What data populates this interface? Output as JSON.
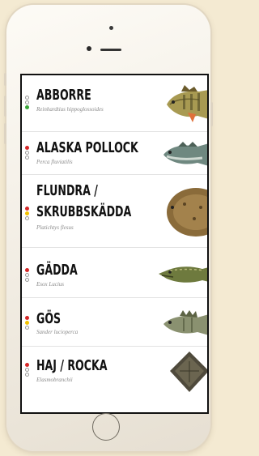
{
  "colors": {
    "background": "#f4ead2",
    "dot_red": "#d62828",
    "dot_yellow": "#f2c200",
    "dot_green": "#3aa63a",
    "dot_empty_border": "#9a9a9a"
  },
  "fish_list": [
    {
      "name_line1": "ABBORRE",
      "name_line2": "",
      "latin": "Reinhardtius hippoglossoides",
      "status": "green",
      "icon": "perch-icon"
    },
    {
      "name_line1": "ALASKA POLLOCK",
      "name_line2": "",
      "latin": "Perca fluviatilis",
      "status": "red",
      "icon": "pollock-icon"
    },
    {
      "name_line1": "FLUNDRA /",
      "name_line2": "SKRUBBSKÄDDA",
      "latin": "Platichtys flesus",
      "status": "red-yellow",
      "icon": "flounder-icon"
    },
    {
      "name_line1": "GÄDDA",
      "name_line2": "",
      "latin": "Esox Lucius",
      "status": "red",
      "icon": "pike-icon"
    },
    {
      "name_line1": "GÖS",
      "name_line2": "",
      "latin": "Sander lucioperca",
      "status": "red-yellow",
      "icon": "zander-icon"
    },
    {
      "name_line1": "HAJ / ROCKA",
      "name_line2": "",
      "latin": "Elasmobranchii",
      "status": "red",
      "icon": "ray-icon"
    }
  ]
}
